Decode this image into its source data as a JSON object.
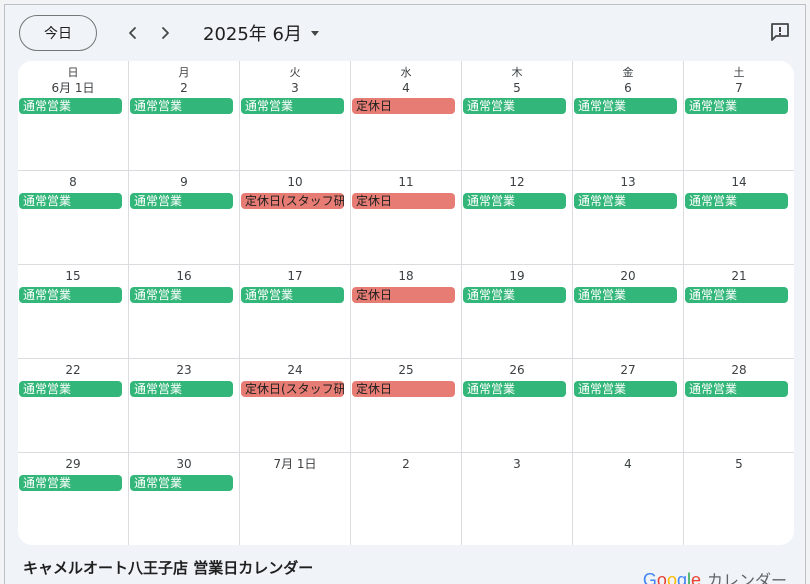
{
  "toolbar": {
    "today_label": "今日",
    "prev_icon": "chevron-left-icon",
    "next_icon": "chevron-right-icon",
    "month_label": "2025年 6月",
    "feedback_icon": "feedback-icon"
  },
  "weekdays": [
    "日",
    "月",
    "火",
    "水",
    "木",
    "金",
    "土"
  ],
  "days": [
    {
      "date": "6月 1日",
      "event": "通常営業",
      "status": "open"
    },
    {
      "date": "2",
      "event": "通常営業",
      "status": "open"
    },
    {
      "date": "3",
      "event": "通常営業",
      "status": "open"
    },
    {
      "date": "4",
      "event": "定休日",
      "status": "closed"
    },
    {
      "date": "5",
      "event": "通常営業",
      "status": "open"
    },
    {
      "date": "6",
      "event": "通常営業",
      "status": "open"
    },
    {
      "date": "7",
      "event": "通常営業",
      "status": "open"
    },
    {
      "date": "8",
      "event": "通常営業",
      "status": "open"
    },
    {
      "date": "9",
      "event": "通常営業",
      "status": "open"
    },
    {
      "date": "10",
      "event": "定休日(スタッフ研修)",
      "status": "closed"
    },
    {
      "date": "11",
      "event": "定休日",
      "status": "closed"
    },
    {
      "date": "12",
      "event": "通常営業",
      "status": "open"
    },
    {
      "date": "13",
      "event": "通常営業",
      "status": "open"
    },
    {
      "date": "14",
      "event": "通常営業",
      "status": "open"
    },
    {
      "date": "15",
      "event": "通常営業",
      "status": "open"
    },
    {
      "date": "16",
      "event": "通常営業",
      "status": "open"
    },
    {
      "date": "17",
      "event": "通常営業",
      "status": "open"
    },
    {
      "date": "18",
      "event": "定休日",
      "status": "closed"
    },
    {
      "date": "19",
      "event": "通常営業",
      "status": "open"
    },
    {
      "date": "20",
      "event": "通常営業",
      "status": "open"
    },
    {
      "date": "21",
      "event": "通常営業",
      "status": "open"
    },
    {
      "date": "22",
      "event": "通常営業",
      "status": "open"
    },
    {
      "date": "23",
      "event": "通常営業",
      "status": "open"
    },
    {
      "date": "24",
      "event": "定休日(スタッフ研修)",
      "status": "closed"
    },
    {
      "date": "25",
      "event": "定休日",
      "status": "closed"
    },
    {
      "date": "26",
      "event": "通常営業",
      "status": "open"
    },
    {
      "date": "27",
      "event": "通常営業",
      "status": "open"
    },
    {
      "date": "28",
      "event": "通常営業",
      "status": "open"
    },
    {
      "date": "29",
      "event": "通常営業",
      "status": "open"
    },
    {
      "date": "30",
      "event": "通常営業",
      "status": "open"
    },
    {
      "date": "7月 1日",
      "event": "",
      "status": ""
    },
    {
      "date": "2",
      "event": "",
      "status": ""
    },
    {
      "date": "3",
      "event": "",
      "status": ""
    },
    {
      "date": "4",
      "event": "",
      "status": ""
    },
    {
      "date": "5",
      "event": "",
      "status": ""
    }
  ],
  "footer": {
    "calendar_title": "キャメルオート八王子店 営業日カレンダー",
    "brand_letters": [
      "G",
      "o",
      "o",
      "g",
      "l",
      "e"
    ],
    "brand_colors": [
      "#4285f4",
      "#ea4335",
      "#fbbc05",
      "#4285f4",
      "#34a853",
      "#ea4335"
    ],
    "product_label": "カレンダー"
  },
  "colors": {
    "open": "#33b679",
    "closed": "#e67c73"
  }
}
